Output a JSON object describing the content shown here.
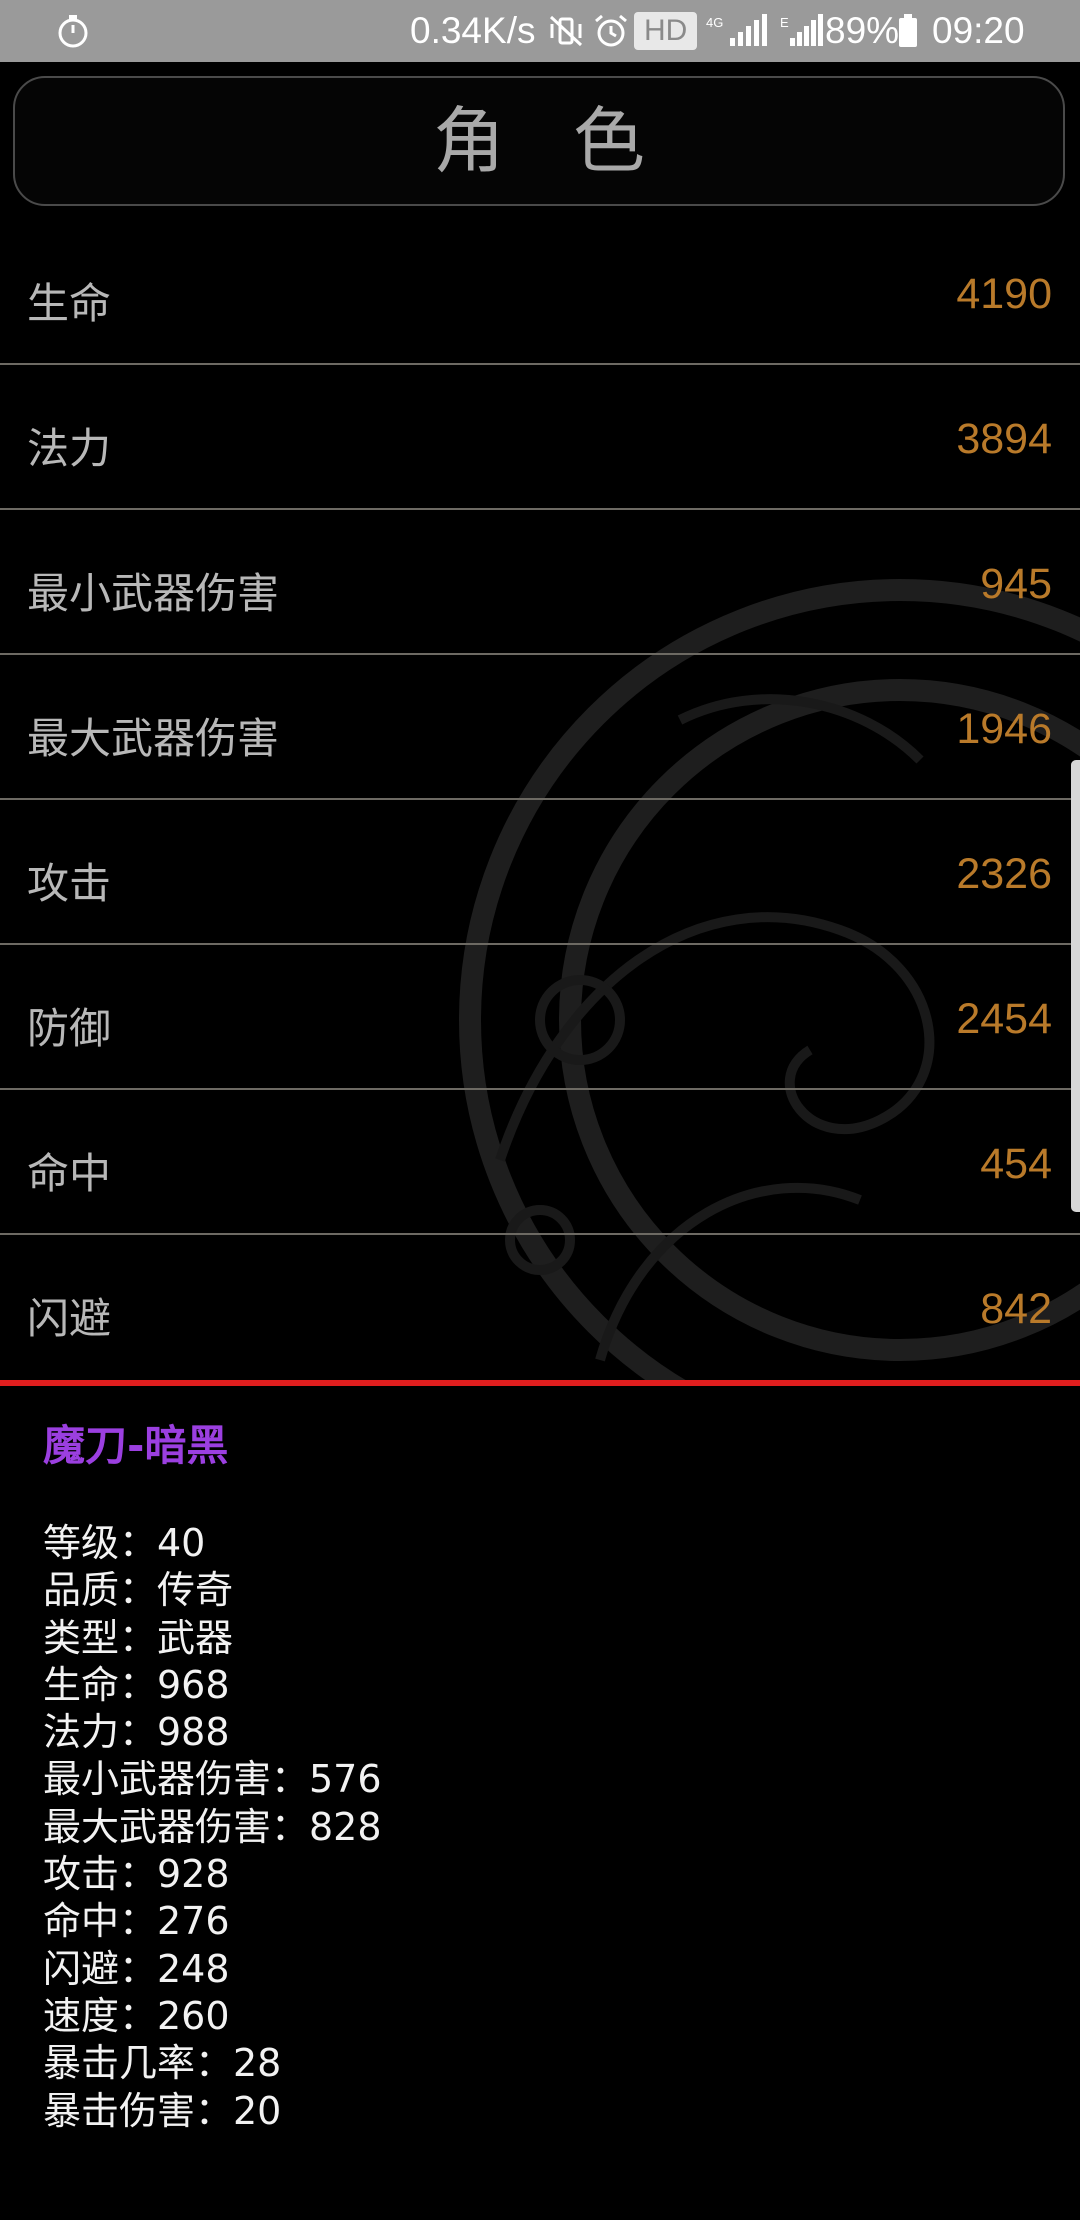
{
  "status_bar": {
    "network_speed": "0.34K/s",
    "hd_label": "HD",
    "signal_1_label": "4G",
    "signal_2_label": "E",
    "battery_percent": "89%",
    "time": "09:20"
  },
  "header": {
    "title": "角色"
  },
  "stats": [
    {
      "label": "生命",
      "value": "4190"
    },
    {
      "label": "法力",
      "value": "3894"
    },
    {
      "label": "最小武器伤害",
      "value": "945"
    },
    {
      "label": "最大武器伤害",
      "value": "1946"
    },
    {
      "label": "攻击",
      "value": "2326"
    },
    {
      "label": "防御",
      "value": "2454"
    },
    {
      "label": "命中",
      "value": "454"
    },
    {
      "label": "闪避",
      "value": "842"
    }
  ],
  "item": {
    "name": "魔刀-暗黑",
    "properties": [
      "等级：40",
      "品质：传奇",
      "类型：武器",
      "生命：968",
      "法力：988",
      "最小武器伤害：576",
      "最大武器伤害：828",
      "攻击：928",
      "命中：276",
      "闪避：248",
      "速度：260",
      "暴击几率：28",
      "暴击伤害：20"
    ]
  },
  "colors": {
    "value_accent": "#b97a2a",
    "item_name": "#9b3fe0",
    "divider": "#e01e1e"
  }
}
